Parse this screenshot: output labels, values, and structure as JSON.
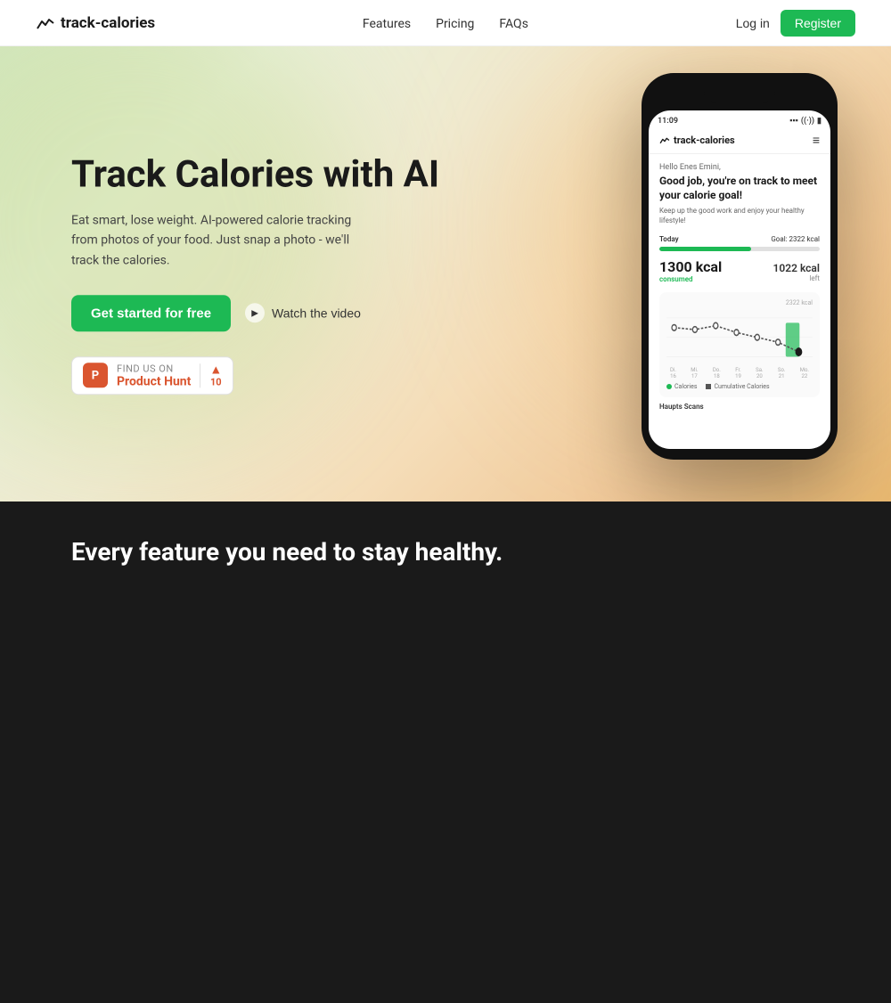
{
  "navbar": {
    "logo_text": "track-calories",
    "links": [
      {
        "label": "Features",
        "id": "features"
      },
      {
        "label": "Pricing",
        "id": "pricing"
      },
      {
        "label": "FAQs",
        "id": "faqs"
      }
    ],
    "login_label": "Log in",
    "register_label": "Register"
  },
  "hero": {
    "title": "Track Calories with AI",
    "subtitle": "Eat smart, lose weight. AI-powered calorie tracking from photos of your food. Just snap a photo - we'll track the calories.",
    "cta_label": "Get started for free",
    "watch_label": "Watch the video",
    "product_hunt": {
      "find_text": "FIND US ON",
      "name": "Product Hunt",
      "score": "10"
    }
  },
  "phone": {
    "status_time": "11:09",
    "app_name": "track-calories",
    "greeting": "Hello Enes Emini,",
    "headline": "Good job, you're on track to meet your calorie goal!",
    "subtext": "Keep up the good work and enjoy your healthy lifestyle!",
    "today_label": "Today",
    "goal_label": "Goal: 2322 kcal",
    "consumed_kcal": "1300 kcal",
    "consumed_label": "consumed",
    "left_kcal": "1022 kcal",
    "left_label": "left",
    "chart_y_label": "2322 kcal",
    "chart_x_labels": [
      "Di. 16",
      "Mi. 17",
      "Do. 18",
      "Fr. 19",
      "Sa. 20",
      "So. 21",
      "Mo. 22"
    ],
    "legend_calories": "Calories",
    "legend_cumulative": "Cumulative Calories",
    "section_title": "Haupts Scans"
  },
  "bottom": {
    "title": "Every feature you need to stay healthy."
  },
  "icons": {
    "logo": "mountain-icon",
    "menu": "≡",
    "play": "▶"
  }
}
